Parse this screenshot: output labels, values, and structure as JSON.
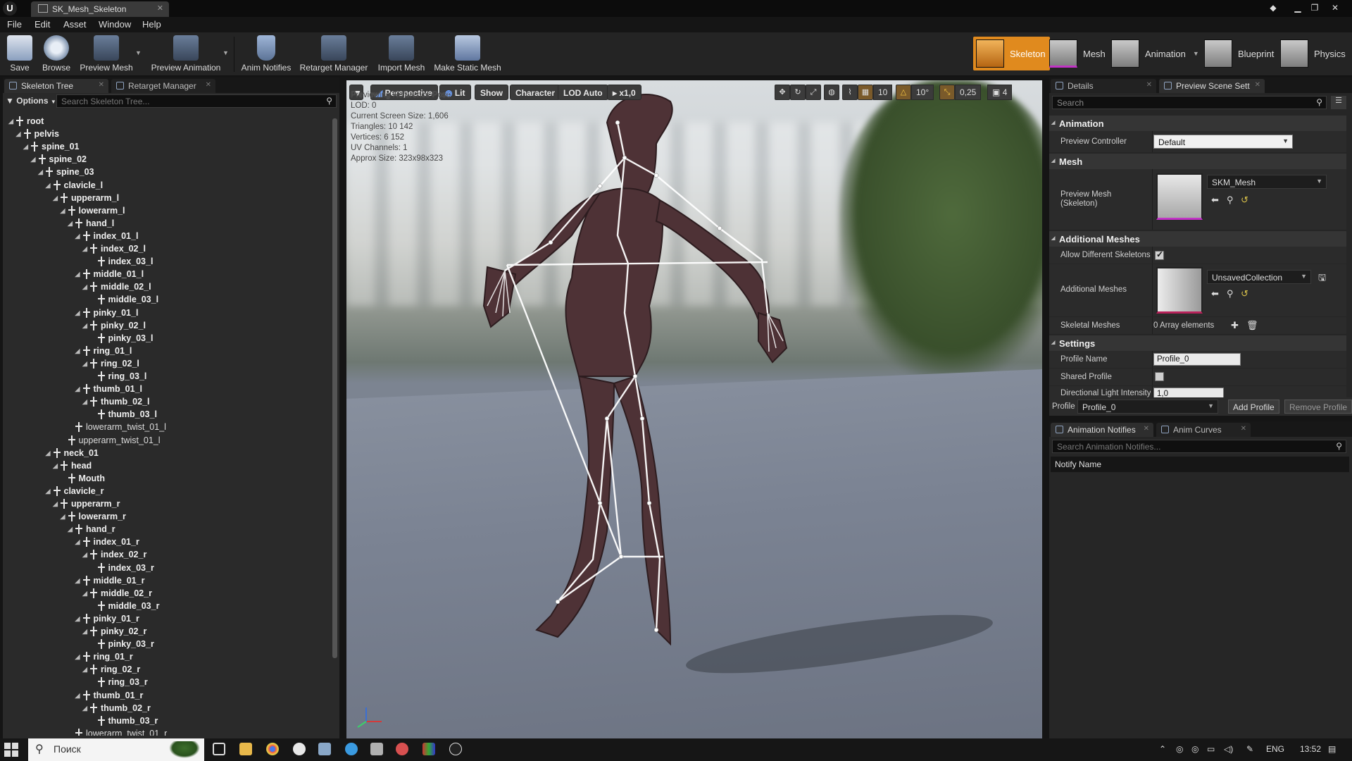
{
  "window": {
    "tab_title": "SK_Mesh_Skeleton",
    "logo": "ue-logo"
  },
  "menu": [
    "File",
    "Edit",
    "Asset",
    "Window",
    "Help"
  ],
  "toolbar": {
    "buttons": [
      {
        "label": "Save",
        "icon": "save-icon"
      },
      {
        "label": "Browse",
        "icon": "browse-icon"
      },
      {
        "label": "Preview Mesh",
        "icon": "preview-mesh-icon"
      },
      {
        "label": "Preview Animation",
        "icon": "preview-animation-icon"
      },
      {
        "label": "Anim Notifies",
        "icon": "anim-notifies-icon"
      },
      {
        "label": "Retarget Manager",
        "icon": "retarget-manager-icon"
      },
      {
        "label": "Import Mesh",
        "icon": "import-mesh-icon"
      },
      {
        "label": "Make Static Mesh",
        "icon": "make-static-mesh-icon"
      }
    ],
    "modes": [
      {
        "label": "Skeleton",
        "active": true
      },
      {
        "label": "Mesh",
        "active": false
      },
      {
        "label": "Animation",
        "active": false
      },
      {
        "label": "Blueprint",
        "active": false
      },
      {
        "label": "Physics",
        "active": false
      }
    ],
    "accent_color": "#e08a1e"
  },
  "skeleton_panel": {
    "tabs": [
      "Skeleton Tree",
      "Retarget Manager"
    ],
    "options_label": "Options",
    "search_placeholder": "Search Skeleton Tree...",
    "bones": [
      {
        "name": "root",
        "depth": 0,
        "expandable": true
      },
      {
        "name": "pelvis",
        "depth": 1,
        "expandable": true
      },
      {
        "name": "spine_01",
        "depth": 2,
        "expandable": true
      },
      {
        "name": "spine_02",
        "depth": 3,
        "expandable": true
      },
      {
        "name": "spine_03",
        "depth": 4,
        "expandable": true
      },
      {
        "name": "clavicle_l",
        "depth": 5,
        "expandable": true
      },
      {
        "name": "upperarm_l",
        "depth": 6,
        "expandable": true
      },
      {
        "name": "lowerarm_l",
        "depth": 7,
        "expandable": true
      },
      {
        "name": "hand_l",
        "depth": 8,
        "expandable": true
      },
      {
        "name": "index_01_l",
        "depth": 9,
        "expandable": true
      },
      {
        "name": "index_02_l",
        "depth": 10,
        "expandable": true
      },
      {
        "name": "index_03_l",
        "depth": 11,
        "expandable": false
      },
      {
        "name": "middle_01_l",
        "depth": 9,
        "expandable": true
      },
      {
        "name": "middle_02_l",
        "depth": 10,
        "expandable": true
      },
      {
        "name": "middle_03_l",
        "depth": 11,
        "expandable": false
      },
      {
        "name": "pinky_01_l",
        "depth": 9,
        "expandable": true
      },
      {
        "name": "pinky_02_l",
        "depth": 10,
        "expandable": true
      },
      {
        "name": "pinky_03_l",
        "depth": 11,
        "expandable": false
      },
      {
        "name": "ring_01_l",
        "depth": 9,
        "expandable": true
      },
      {
        "name": "ring_02_l",
        "depth": 10,
        "expandable": true
      },
      {
        "name": "ring_03_l",
        "depth": 11,
        "expandable": false
      },
      {
        "name": "thumb_01_l",
        "depth": 9,
        "expandable": true
      },
      {
        "name": "thumb_02_l",
        "depth": 10,
        "expandable": true
      },
      {
        "name": "thumb_03_l",
        "depth": 11,
        "expandable": false
      },
      {
        "name": "lowerarm_twist_01_l",
        "depth": 8,
        "expandable": false,
        "light": true
      },
      {
        "name": "upperarm_twist_01_l",
        "depth": 7,
        "expandable": false,
        "light": true
      },
      {
        "name": "neck_01",
        "depth": 5,
        "expandable": true
      },
      {
        "name": "head",
        "depth": 6,
        "expandable": true
      },
      {
        "name": "Mouth",
        "depth": 7,
        "expandable": false
      },
      {
        "name": "clavicle_r",
        "depth": 5,
        "expandable": true
      },
      {
        "name": "upperarm_r",
        "depth": 6,
        "expandable": true
      },
      {
        "name": "lowerarm_r",
        "depth": 7,
        "expandable": true
      },
      {
        "name": "hand_r",
        "depth": 8,
        "expandable": true
      },
      {
        "name": "index_01_r",
        "depth": 9,
        "expandable": true
      },
      {
        "name": "index_02_r",
        "depth": 10,
        "expandable": true
      },
      {
        "name": "index_03_r",
        "depth": 11,
        "expandable": false
      },
      {
        "name": "middle_01_r",
        "depth": 9,
        "expandable": true
      },
      {
        "name": "middle_02_r",
        "depth": 10,
        "expandable": true
      },
      {
        "name": "middle_03_r",
        "depth": 11,
        "expandable": false
      },
      {
        "name": "pinky_01_r",
        "depth": 9,
        "expandable": true
      },
      {
        "name": "pinky_02_r",
        "depth": 10,
        "expandable": true
      },
      {
        "name": "pinky_03_r",
        "depth": 11,
        "expandable": false
      },
      {
        "name": "ring_01_r",
        "depth": 9,
        "expandable": true
      },
      {
        "name": "ring_02_r",
        "depth": 10,
        "expandable": true
      },
      {
        "name": "ring_03_r",
        "depth": 11,
        "expandable": false
      },
      {
        "name": "thumb_01_r",
        "depth": 9,
        "expandable": true
      },
      {
        "name": "thumb_02_r",
        "depth": 10,
        "expandable": true
      },
      {
        "name": "thumb_03_r",
        "depth": 11,
        "expandable": false
      },
      {
        "name": "lowerarm_twist_01_r",
        "depth": 8,
        "expandable": false,
        "light": true
      }
    ]
  },
  "viewport": {
    "mode_labels": {
      "perspective": "Perspective",
      "lit": "Lit",
      "show": "Show",
      "character": "Character",
      "lod": "LOD Auto",
      "speed": "x1,0"
    },
    "snap_values": {
      "grid": "10",
      "rotation": "10°",
      "scale": "0,25",
      "camera_speed": "4"
    },
    "info": [
      "Previewing Reference Pose",
      "LOD: 0",
      "Current Screen Size: 1,606",
      "Triangles: 10 142",
      "Vertices: 6 152",
      "UV Channels: 1",
      "Approx Size: 323x98x323"
    ]
  },
  "details_panel": {
    "tabs": [
      "Details",
      "Preview Scene Sett"
    ],
    "search_placeholder": "Search",
    "sections": {
      "animation": "Animation",
      "mesh": "Mesh",
      "additional_meshes": "Additional Meshes",
      "settings": "Settings"
    },
    "preview_controller": {
      "label": "Preview Controller",
      "value": "Default"
    },
    "preview_mesh": {
      "label": "Preview Mesh (Skeleton)",
      "value": "SKM_Mesh"
    },
    "allow_different_skeletons": {
      "label": "Allow Different Skeletons",
      "checked": true
    },
    "additional_meshes": {
      "label": "Additional Meshes",
      "value": "UnsavedCollection"
    },
    "skeletal_meshes": {
      "label": "Skeletal Meshes",
      "value": "0 Array elements"
    },
    "profile_name": {
      "label": "Profile Name",
      "value": "Profile_0"
    },
    "shared_profile": {
      "label": "Shared Profile",
      "checked": false
    },
    "directional_light": {
      "label": "Directional Light Intensity",
      "value": "1,0"
    },
    "profile_bar": {
      "label": "Profile",
      "value": "Profile_0",
      "add": "Add Profile",
      "remove": "Remove Profile"
    }
  },
  "notify_panel": {
    "tabs": [
      "Animation Notifies",
      "Anim Curves"
    ],
    "search_placeholder": "Search Animation Notifies...",
    "column_header": "Notify Name"
  },
  "taskbar": {
    "search_text": "Поиск",
    "language": "ENG",
    "time": "13:52"
  }
}
